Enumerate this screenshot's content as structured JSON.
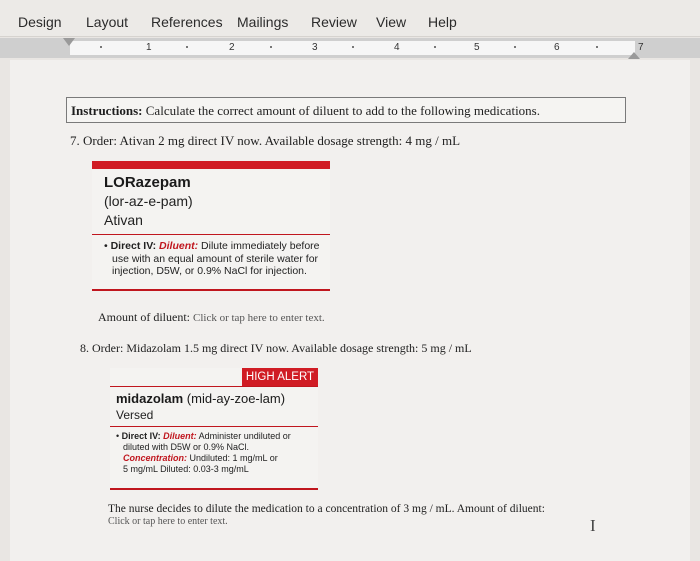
{
  "ribbon": {
    "tabs": [
      "Design",
      "Layout",
      "References",
      "Mailings",
      "Review",
      "View",
      "Help"
    ]
  },
  "ruler": {
    "numbers": [
      "1",
      "2",
      "3",
      "4",
      "5",
      "6",
      "7"
    ]
  },
  "document": {
    "instructions_label": "Instructions:",
    "instructions_text": " Calculate the correct amount of diluent to add to the following medications.",
    "q7": "7.  Order: Ativan 2 mg direct IV now. Available dosage strength: 4 mg / mL",
    "card1": {
      "drug": "LORazepam",
      "pron": "(lor-az-e-pam)",
      "brand": "Ativan",
      "bullet_label": "Direct IV: ",
      "diluent_label": "Diluent:",
      "line1": " Dilute immediately before",
      "line2": "use with an equal amount of sterile water for",
      "line3": "injection, D5W, or 0.9% NaCl for injection."
    },
    "amount_label": "Amount of diluent: ",
    "placeholder": "Click or tap here to enter text.",
    "q8": "8.  Order: Midazolam 1.5 mg direct IV now. Available dosage strength: 5 mg / mL",
    "card2": {
      "high_alert": "HIGH ALERT",
      "drug": "midazolam",
      "pron": " (mid-ay-zoe-lam)",
      "brand": "Versed",
      "bullet_label": "Direct IV: ",
      "diluent_label": "Diluent:",
      "line1": " Administer undiluted or",
      "line2": "diluted with D5W or 0.9% NaCl.",
      "conc_label": "Concentration:",
      "line3": " Undiluted: 1 mg/mL or",
      "line4": "5 mg/mL Diluted: 0.03-3 mg/mL"
    },
    "nurse_text": "The nurse decides to dilute the medication to a concentration of 3 mg / mL. Amount of diluent:",
    "nurse_placeholder": "Click or tap here to enter text."
  },
  "icons": {
    "cursor": "text-cursor-icon"
  }
}
